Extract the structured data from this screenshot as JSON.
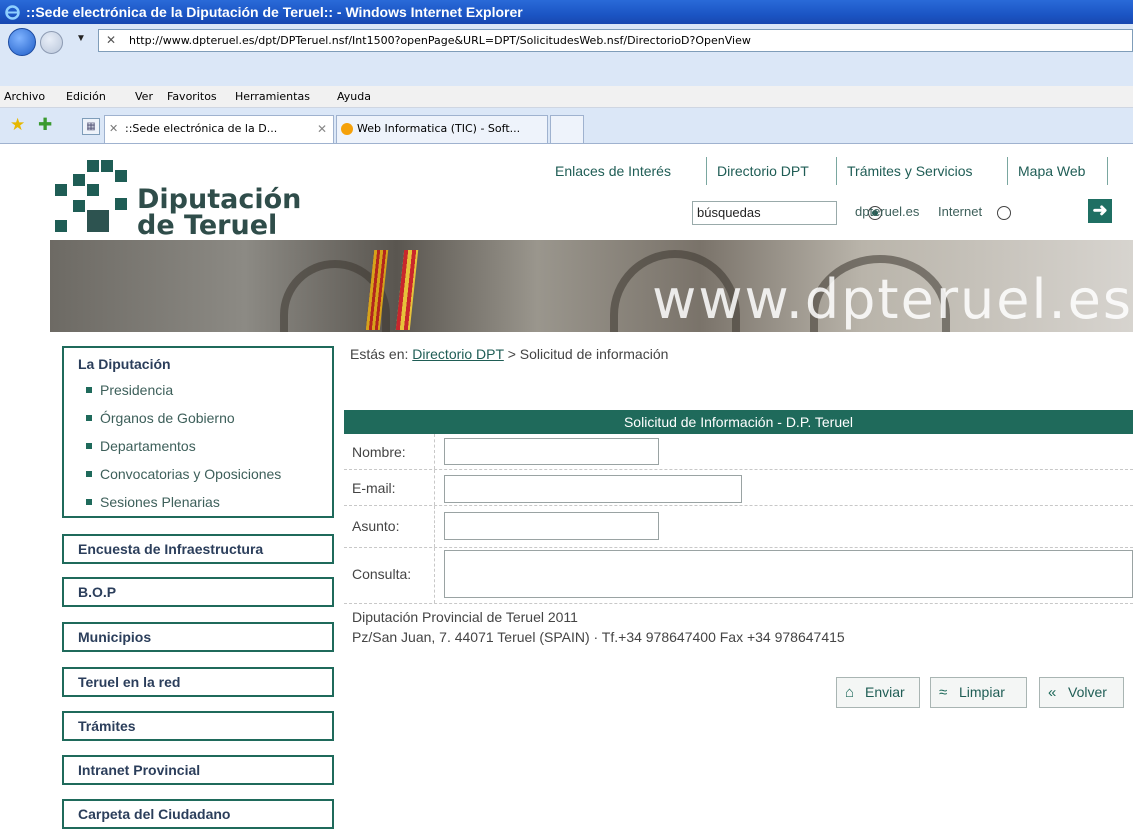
{
  "browser": {
    "title": "::Sede electrónica de la Diputación de Teruel:: - Windows Internet Explorer",
    "url": "http://www.dpteruel.es/dpt/DPTeruel.nsf/Int1500?openPage&URL=DPT/SolicitudesWeb.nsf/DirectorioD?OpenView",
    "menu": [
      "Archivo",
      "Edición",
      "Ver",
      "Favoritos",
      "Herramientas",
      "Ayuda"
    ],
    "tabs": [
      {
        "label": "::Sede electrónica de la D...",
        "active": true
      },
      {
        "label": "Web Informatica (TIC) - Soft...",
        "active": false
      }
    ]
  },
  "site": {
    "logo_line1": "Diputación",
    "logo_line2": "de Teruel",
    "topnav": [
      "Enlaces de Interés",
      "Directorio DPT",
      "Trámites y Servicios",
      "Mapa Web"
    ],
    "search_value": "búsquedas",
    "scope_options": [
      {
        "label": "dpteruel.es",
        "selected": true
      },
      {
        "label": "Internet",
        "selected": false
      }
    ],
    "banner_text": "www.dpteruel.es"
  },
  "sidebar": {
    "section_title": "La Diputación",
    "items": [
      "Presidencia",
      "Órganos de Gobierno",
      "Departamentos",
      "Convocatorias y Oposiciones",
      "Sesiones Plenarias"
    ],
    "buttons": [
      "Encuesta de Infraestructura",
      "B.O.P",
      "Municipios",
      "Teruel en la red",
      "Trámites",
      "Intranet Provincial",
      "Carpeta del Ciudadano"
    ]
  },
  "breadcrumb": {
    "prefix": "Estás en:",
    "link": "Directorio DPT",
    "current": "> Solicitud de información"
  },
  "form": {
    "title": "Solicitud de Información - D.P. Teruel",
    "fields": [
      {
        "label": "Nombre:",
        "value": ""
      },
      {
        "label": "E-mail:",
        "value": ""
      },
      {
        "label": "Asunto:",
        "value": ""
      },
      {
        "label": "Consulta:",
        "value": ""
      }
    ]
  },
  "footer": {
    "line1": "Diputación Provincial de Teruel 2011",
    "line2": "Pz/San Juan, 7. 44071 Teruel (SPAIN) · Tf.+34 978647400 Fax +34 978647415"
  },
  "actions": [
    "Enviar",
    "Limpiar",
    "Volver"
  ],
  "colors": {
    "accent": "#1f6a5b",
    "title_bar": "#1b55c4"
  }
}
